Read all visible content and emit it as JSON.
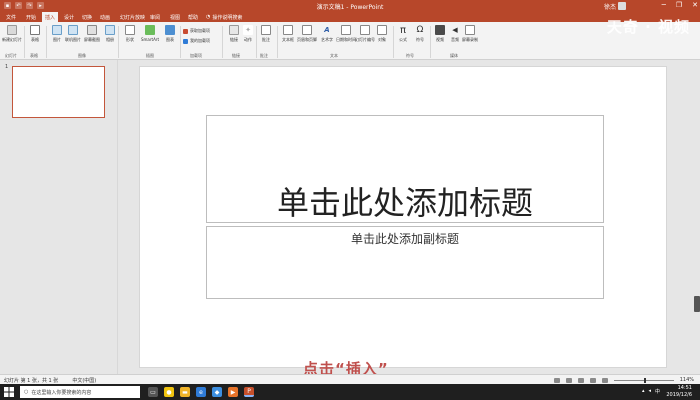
{
  "titlebar": {
    "title": "演示文稿1 - PowerPoint",
    "user": "徐杰",
    "window_buttons": [
      "─",
      "❐",
      "✕"
    ],
    "qat_icons": [
      "save-icon",
      "undo-icon",
      "redo-icon",
      "present-icon"
    ],
    "qat_glyphs": [
      "▪",
      "↶",
      "↷",
      "▸"
    ]
  },
  "tabs": [
    {
      "label": "文件"
    },
    {
      "label": "开始"
    },
    {
      "label": "插入"
    },
    {
      "label": "设计"
    },
    {
      "label": "切换"
    },
    {
      "label": "动画"
    },
    {
      "label": "幻灯片放映"
    },
    {
      "label": "审阅"
    },
    {
      "label": "视图"
    },
    {
      "label": "帮助"
    }
  ],
  "active_tab": "插入",
  "tell_me": "操作说明搜索",
  "ribbon": {
    "new_slide": "新建幻灯片",
    "table": "表格",
    "pictures": "图片",
    "online_pictures": "联机图片",
    "screenshot": "屏幕截图",
    "album": "相册",
    "shapes": "形状",
    "smartart": "SmartArt",
    "chart": "图表",
    "get_addins": "获取加载项",
    "my_addins": "我的加载项",
    "link": "链接",
    "action": "动作",
    "comment": "批注",
    "textbox": "文本框",
    "header_footer": "页眉和页脚",
    "wordart": "艺术字",
    "date_time": "日期和时间",
    "slide_number": "幻灯片编号",
    "object": "对象",
    "equation": "公式",
    "symbol": "符号",
    "video": "视频",
    "audio": "音频",
    "screen_recording": "屏幕录制",
    "groups": [
      "幻灯片",
      "表格",
      "图像",
      "插图",
      "加载项",
      "链接",
      "批注",
      "文本",
      "符号",
      "媒体"
    ]
  },
  "watermark": "天奇 · 视频",
  "thumbnail_number": "1",
  "slide": {
    "title_placeholder": "单击此处添加标题",
    "subtitle_placeholder": "单击此处添加副标题"
  },
  "caption": "点击“插入”",
  "statusbar": {
    "slide_info": "幻灯片 第 1 张，共 1 张",
    "language": "中文(中国)",
    "zoom": "114%"
  },
  "taskbar": {
    "search_placeholder": "在这里输入你要搜索的内容",
    "time": "14:51",
    "date": "2019/12/6",
    "tray_language": "中",
    "apps": [
      {
        "name": "task-view-icon",
        "color": "#555555",
        "glyph": "▭"
      },
      {
        "name": "chrome-icon",
        "color": "#f1c40f",
        "glyph": "●"
      },
      {
        "name": "file-explorer-icon",
        "color": "#f0b429",
        "glyph": "▬"
      },
      {
        "name": "edge-icon",
        "color": "#2f7bd6",
        "glyph": "e"
      },
      {
        "name": "app-blue-icon",
        "color": "#3d8fe0",
        "glyph": "◆"
      },
      {
        "name": "app-orange-icon",
        "color": "#e8742a",
        "glyph": "▶"
      },
      {
        "name": "powerpoint-icon",
        "color": "#c6502c",
        "glyph": "P"
      }
    ]
  },
  "colors": {
    "accent": "#b7472a",
    "caption": "#c0504d"
  }
}
